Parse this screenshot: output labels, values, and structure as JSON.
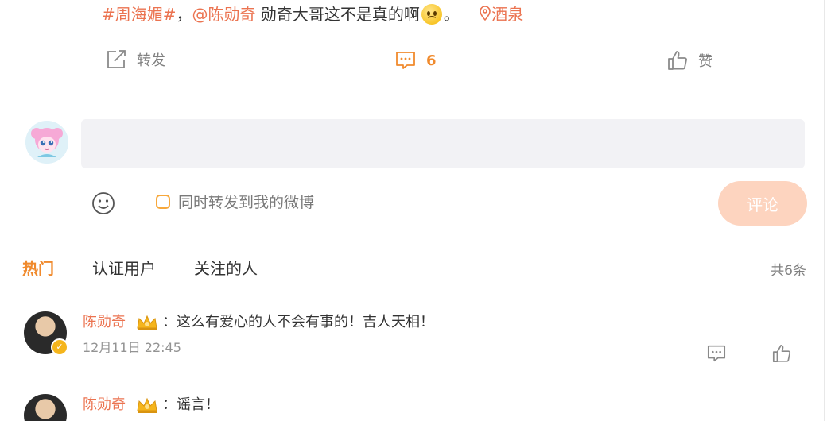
{
  "post": {
    "topic": "#周海媚#",
    "separator": "，",
    "mention": "@陈勋奇",
    "text": " 勋奇大哥这不是真的啊",
    "emoji_name": "sad-face-emoji",
    "after_emoji": "。",
    "location": "酒泉"
  },
  "actions": {
    "repost_label": "转发",
    "comment_count": "6",
    "like_label": "赞"
  },
  "composer": {
    "placeholder": "",
    "forward_label": "同时转发到我的微博",
    "submit_label": "评论"
  },
  "tabs": [
    {
      "label": "热门"
    },
    {
      "label": "认证用户"
    },
    {
      "label": "关注的人"
    }
  ],
  "total_count": "共6条",
  "replies": [
    {
      "user": "陈勋奇",
      "text": "：这么有爱心的人不会有事的！吉人天相！",
      "time": "12月11日 22:45"
    },
    {
      "user": "陈勋奇",
      "text": "：谣言！"
    }
  ],
  "colors": {
    "accent": "#eb7350",
    "orange": "#f08a2d",
    "input_bg": "#f2f2f5",
    "submit_disabled": "#fdd4bf"
  }
}
